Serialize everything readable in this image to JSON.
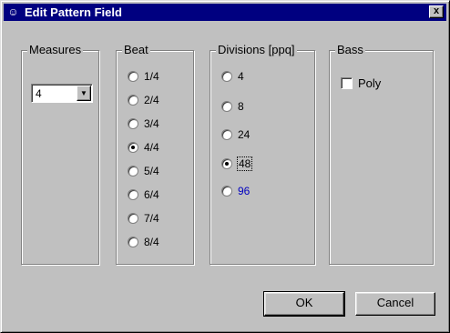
{
  "window": {
    "title": "Edit Pattern Field",
    "icon": "app-icon",
    "close_label": "x"
  },
  "measures": {
    "legend": "Measures",
    "selected": "4"
  },
  "beat": {
    "legend": "Beat",
    "options": [
      "1/4",
      "2/4",
      "3/4",
      "4/4",
      "5/4",
      "6/4",
      "7/4",
      "8/4"
    ],
    "selected": "4/4"
  },
  "divisions": {
    "legend": "Divisions [ppq]",
    "options": [
      "4",
      "8",
      "24",
      "48",
      "96"
    ],
    "selected": "48",
    "highlight_color": "#0000c0"
  },
  "bass": {
    "legend": "Bass",
    "poly_label": "Poly",
    "poly_checked": false
  },
  "buttons": {
    "ok_label": "OK",
    "cancel_label": "Cancel"
  }
}
